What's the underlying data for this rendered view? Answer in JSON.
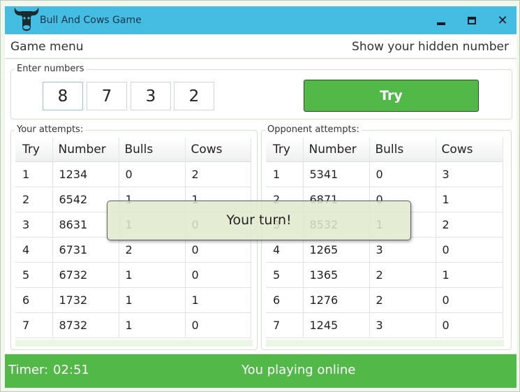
{
  "window": {
    "title": "Bull And Cows Game",
    "icon": "bull-head-icon",
    "controls": [
      "minimize-icon",
      "maximize-icon",
      "close-icon"
    ],
    "close_glyph": "✕"
  },
  "menu": {
    "game_menu": "Game menu",
    "show_hidden": "Show your hidden number"
  },
  "input": {
    "label": "Enter numbers",
    "digits": [
      "8",
      "7",
      "3",
      "2"
    ],
    "try_label": "Try"
  },
  "your_attempts": {
    "label": "Your attempts:",
    "columns": [
      "Try",
      "Number",
      "Bulls",
      "Cows"
    ],
    "rows": [
      [
        "1",
        "1234",
        "0",
        "2"
      ],
      [
        "2",
        "6542",
        "1",
        "1"
      ],
      [
        "3",
        "8631",
        "1",
        "0"
      ],
      [
        "4",
        "6731",
        "2",
        "0"
      ],
      [
        "5",
        "6732",
        "1",
        "0"
      ],
      [
        "6",
        "1732",
        "1",
        "1"
      ],
      [
        "7",
        "8732",
        "1",
        "0"
      ]
    ]
  },
  "opponent_attempts": {
    "label": "Opponent attempts:",
    "columns": [
      "Try",
      "Number",
      "Bulls",
      "Cows"
    ],
    "rows": [
      [
        "1",
        "5341",
        "0",
        "3"
      ],
      [
        "2",
        "6871",
        "0",
        "1"
      ],
      [
        "3",
        "8532",
        "1",
        "2"
      ],
      [
        "4",
        "1265",
        "3",
        "0"
      ],
      [
        "5",
        "1365",
        "2",
        "1"
      ],
      [
        "6",
        "1276",
        "2",
        "0"
      ],
      [
        "7",
        "1245",
        "3",
        "0"
      ]
    ]
  },
  "toast": {
    "text": "Your turn!"
  },
  "status": {
    "timer_label": "Timer:",
    "timer_value": "02:51",
    "connection": "You playing online"
  },
  "colors": {
    "titlebar": "#45bde3",
    "accent_green": "#52b847",
    "toast_bg": "#e1e9cd"
  }
}
